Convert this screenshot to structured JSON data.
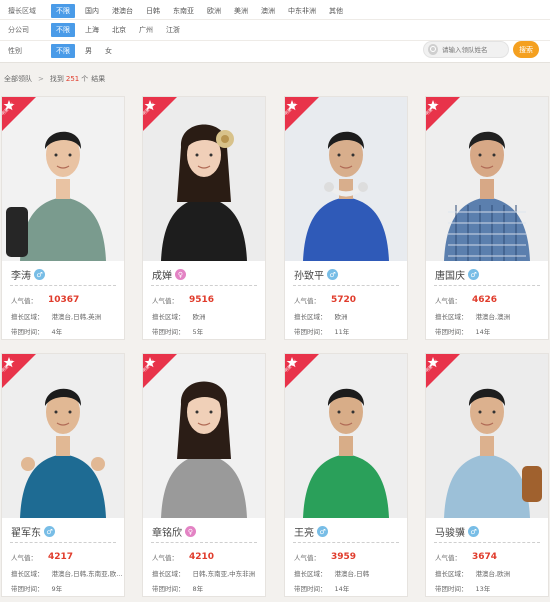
{
  "filters": [
    {
      "label": "擅长区域",
      "options": [
        "不限",
        "国内",
        "港澳台",
        "日韩",
        "东南亚",
        "欧洲",
        "美洲",
        "澳洲",
        "中东非洲",
        "其他"
      ]
    },
    {
      "label": "分公司",
      "options": [
        "不限",
        "上海",
        "北京",
        "广州",
        "江浙"
      ]
    },
    {
      "label": "性别",
      "options": [
        "不限",
        "男",
        "女"
      ]
    }
  ],
  "search": {
    "placeholder": "请输入领队姓名",
    "button": "搜索"
  },
  "breadcrumb": {
    "root": "全部领队",
    "sep": ">",
    "prefix": "找到",
    "count": "251",
    "unit": "个",
    "suffix": "结果"
  },
  "labels": {
    "badge": "明星领队",
    "popularity": "人气值：",
    "region": "擅长区域：",
    "years": "带团时间："
  },
  "leaders": [
    {
      "name": "李涛",
      "gender": "male",
      "popularity": "10367",
      "region": "港澳台,日韩,英洲",
      "years": "4年"
    },
    {
      "name": "成婵",
      "gender": "female",
      "popularity": "9516",
      "region": "欧洲",
      "years": "5年"
    },
    {
      "name": "孙致平",
      "gender": "male",
      "popularity": "5720",
      "region": "欧洲",
      "years": "11年"
    },
    {
      "name": "唐国庆",
      "gender": "male",
      "popularity": "4626",
      "region": "港澳台,澳洲",
      "years": "14年"
    },
    {
      "name": "翟军东",
      "gender": "male",
      "popularity": "4217",
      "region": "港澳台,日韩,东南亚,欧...",
      "years": "9年"
    },
    {
      "name": "章铭欣",
      "gender": "female",
      "popularity": "4210",
      "region": "日韩,东南亚,中东非洲",
      "years": "8年"
    },
    {
      "name": "王亮",
      "gender": "male",
      "popularity": "3959",
      "region": "港澳台,日韩",
      "years": "14年"
    },
    {
      "name": "马骏骥",
      "gender": "male",
      "popularity": "3674",
      "region": "港澳台,欧洲",
      "years": "13年"
    }
  ],
  "colors": {
    "accent": "#4a9be8",
    "popularity": "#e03c2c",
    "search_button": "#f4a020",
    "badge": "#e8334a"
  }
}
